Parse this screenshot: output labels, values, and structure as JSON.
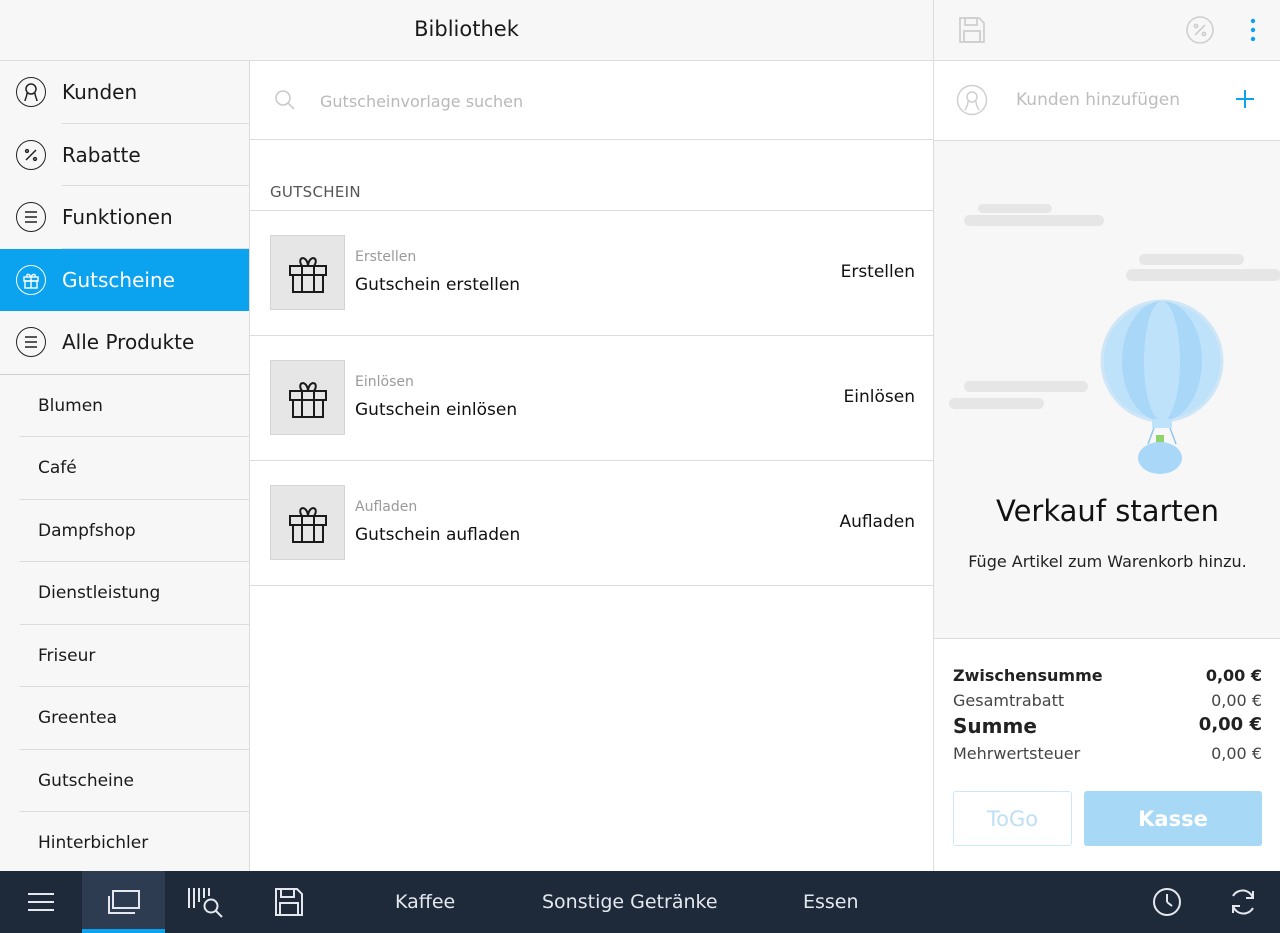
{
  "header": {
    "title": "Bibliothek"
  },
  "sidebar": {
    "categories": [
      {
        "label": "Kunden",
        "icon": "customer-icon"
      },
      {
        "label": "Rabatte",
        "icon": "percent-icon"
      },
      {
        "label": "Funktionen",
        "icon": "list-icon"
      },
      {
        "label": "Gutscheine",
        "icon": "gift-icon",
        "active": true
      },
      {
        "label": "Alle Produkte",
        "icon": "list-icon"
      }
    ],
    "subcategories": [
      "Blumen",
      "Café",
      "Dampfshop",
      "Dienstleistung",
      "Friseur",
      "Greentea",
      "Gutscheine",
      "Hinterbichler"
    ]
  },
  "search": {
    "placeholder": "Gutscheinvorlage suchen",
    "value": ""
  },
  "voucher_section": {
    "heading": "GUTSCHEIN",
    "items": [
      {
        "small": "Erstellen",
        "title": "Gutschein erstellen",
        "action": "Erstellen"
      },
      {
        "small": "Einlösen",
        "title": "Gutschein einlösen",
        "action": "Einlösen"
      },
      {
        "small": "Aufladen",
        "title": "Gutschein aufladen",
        "action": "Aufladen"
      }
    ]
  },
  "cart": {
    "add_customer": "Kunden hinzufügen",
    "empty_title": "Verkauf starten",
    "empty_subtitle": "Füge Artikel zum Warenkorb hinzu.",
    "totals": {
      "subtotal_label": "Zwischensumme",
      "subtotal_value": "0,00 €",
      "discount_label": "Gesamtrabatt",
      "discount_value": "0,00 €",
      "sum_label": "Summe",
      "sum_value": "0,00 €",
      "vat_label": "Mehrwertsteuer",
      "vat_value": "0,00 €"
    },
    "togo_label": "ToGo",
    "checkout_label": "Kasse"
  },
  "bottom_tabs": [
    "Kaffee",
    "Sonstige Getränke",
    "Essen"
  ],
  "colors": {
    "accent": "#0ba2ef",
    "bottom_bar": "#1e2a3a",
    "checkout_disabled": "#a7d8f5"
  }
}
